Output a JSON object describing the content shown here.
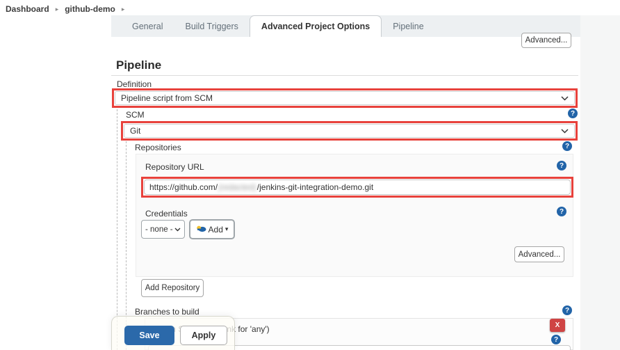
{
  "breadcrumb": {
    "items": [
      {
        "label": "Dashboard"
      },
      {
        "label": "github-demo"
      }
    ]
  },
  "tabs": [
    {
      "label": "General",
      "active": false
    },
    {
      "label": "Build Triggers",
      "active": false
    },
    {
      "label": "Advanced Project Options",
      "active": true
    },
    {
      "label": "Pipeline",
      "active": false
    }
  ],
  "header": {
    "advanced_button": "Advanced..."
  },
  "pipeline": {
    "heading": "Pipeline",
    "definition": {
      "label": "Definition",
      "value": "Pipeline script from SCM"
    },
    "scm": {
      "label": "SCM",
      "value": "Git"
    },
    "repositories": {
      "label": "Repositories",
      "repository_url": {
        "label": "Repository URL",
        "value_prefix": "https://github.com/",
        "value_redacted": "(redacted)",
        "value_suffix": "/jenkins-git-integration-demo.git"
      },
      "credentials": {
        "label": "Credentials",
        "selected": "- none -",
        "add_button": "Add"
      },
      "advanced_button": "Advanced...",
      "add_repository_button": "Add Repository"
    },
    "branches": {
      "label": "Branches to build",
      "branch_specifier_label": "Branch Specifier (blank for 'any')",
      "delete_button": "X"
    }
  },
  "footer": {
    "save_button": "Save",
    "apply_button": "Apply"
  },
  "icons": {
    "help_glyph": "?",
    "caret_down": "▾",
    "breadcrumb_separator": "▸"
  },
  "colors": {
    "highlight_red": "#E8423C",
    "help_blue": "#2264A8",
    "save_blue": "#2B69AA",
    "delete_red": "#CF4444",
    "tab_strip": "#EDF0F2"
  }
}
